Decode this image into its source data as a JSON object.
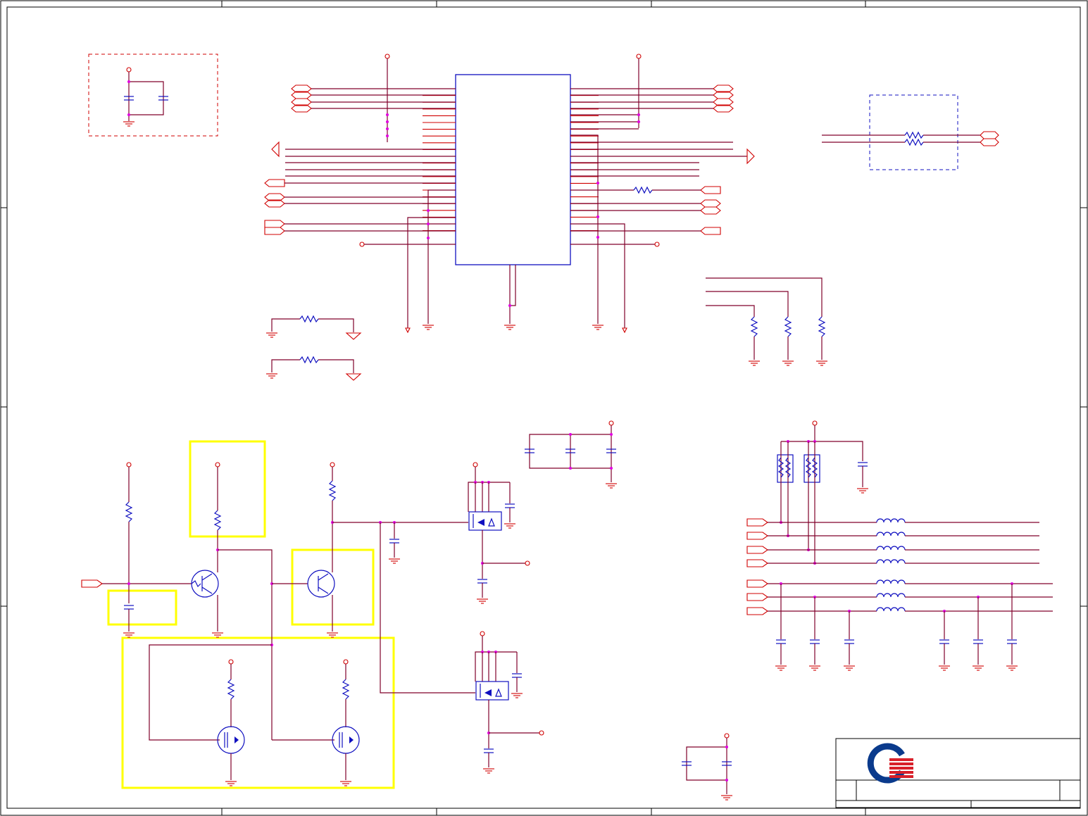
{
  "title_block": {
    "logo": "company-logo"
  },
  "colors": {
    "wire": "#80002a",
    "symbol": "#d00000",
    "component": "#1010c0",
    "junction": "#e000e0",
    "highlight": "#ffff00",
    "logo_blue": "#0a3a8c",
    "logo_red": "#d8202a"
  }
}
